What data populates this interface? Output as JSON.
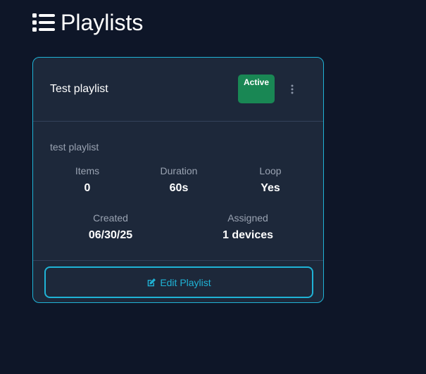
{
  "page": {
    "title": "Playlists",
    "icon": "list-icon"
  },
  "playlist_card": {
    "name": "Test playlist",
    "status": "Active",
    "description": "test playlist",
    "stats": {
      "items_label": "Items",
      "items_value": "0",
      "duration_label": "Duration",
      "duration_value": "60s",
      "loop_label": "Loop",
      "loop_value": "Yes",
      "created_label": "Created",
      "created_value": "06/30/25",
      "assigned_label": "Assigned",
      "assigned_value": "1 devices"
    },
    "edit_button_label": "Edit Playlist",
    "menu_icon": "more-vertical-icon",
    "edit_icon": "edit-icon"
  },
  "colors": {
    "background": "#0e1628",
    "card_background": "#1d283a",
    "accent": "#1fb3d6",
    "status_active": "#198754"
  }
}
